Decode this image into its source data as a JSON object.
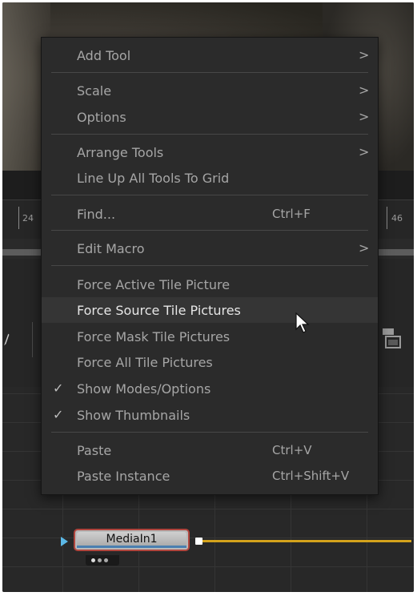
{
  "timeline": {
    "tick_left": "24",
    "tick_right": "46"
  },
  "node": {
    "name": "MediaIn1"
  },
  "menu": {
    "add_tool": "Add Tool",
    "scale": "Scale",
    "options": "Options",
    "arrange_tools": "Arrange Tools",
    "line_up": "Line Up All Tools To Grid",
    "find": "Find...",
    "find_shortcut": "Ctrl+F",
    "edit_macro": "Edit Macro",
    "force_active": "Force Active Tile Picture",
    "force_source": "Force Source Tile Pictures",
    "force_mask": "Force Mask Tile Pictures",
    "force_all": "Force All Tile Pictures",
    "show_modes": "Show Modes/Options",
    "show_thumbnails": "Show Thumbnails",
    "paste": "Paste",
    "paste_shortcut": "Ctrl+V",
    "paste_instance": "Paste Instance",
    "paste_instance_shortcut": "Ctrl+Shift+V",
    "submenu_glyph": ">",
    "check_glyph": "✓"
  },
  "colors": {
    "accent_link": "#d4a21c",
    "node_border": "#b0453d",
    "input_arrow": "#5bb8e6"
  }
}
